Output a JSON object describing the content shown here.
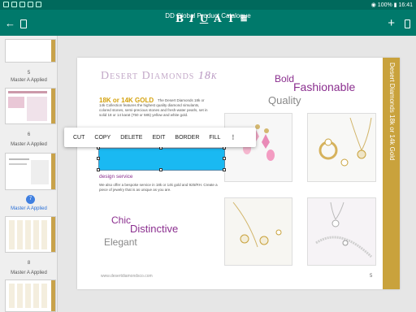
{
  "status_bar": {
    "battery": "100%",
    "time": "16:41"
  },
  "app_bar": {
    "title": "DD Global Product Catalogue",
    "format_buttons": [
      "B",
      "I",
      "U",
      "A",
      "T"
    ]
  },
  "sidebar": {
    "slides": [
      {
        "number": "5",
        "label": "Master A Applied"
      },
      {
        "number": "6",
        "label": "Master A Applied"
      },
      {
        "number": "7",
        "label": "Master A Applied"
      },
      {
        "number": "8",
        "label": "Master A Applied"
      }
    ]
  },
  "context_menu": {
    "items": [
      "CUT",
      "COPY",
      "DELETE",
      "EDIT",
      "BORDER",
      "FILL"
    ]
  },
  "slide": {
    "brand": "Desert Diamonds",
    "brand_suffix": "18k",
    "heading": "18K or 14K GOLD",
    "body": "The Desert Diamonds 18k or 14k Collection features the highest quality diamond simulants, colored stones, semi-precious stones and fresh-water pearls, set in solid 18 or 14 karat (750 or 585) yellow and white gold.",
    "design_heading": "design service",
    "design_body": "We also offer a bespoke service in 18k or 14k gold and 925/RH. Create a piece of jewelry that is as unique as you are.",
    "bold": "Bold",
    "fashionable": "Fashionable",
    "quality": "Quality",
    "chic": "Chic",
    "distinctive": "Distinctive",
    "elegant": "Elegant",
    "website": "www.desertdiamondsco.com",
    "page_number": "5",
    "side_title": "Desert Diamonds 18k or 14k Gold"
  },
  "colors": {
    "teal": "#00796b",
    "gold": "#c9a23c",
    "purple": "#8b2f8f",
    "selection": "#1ab9f2"
  }
}
